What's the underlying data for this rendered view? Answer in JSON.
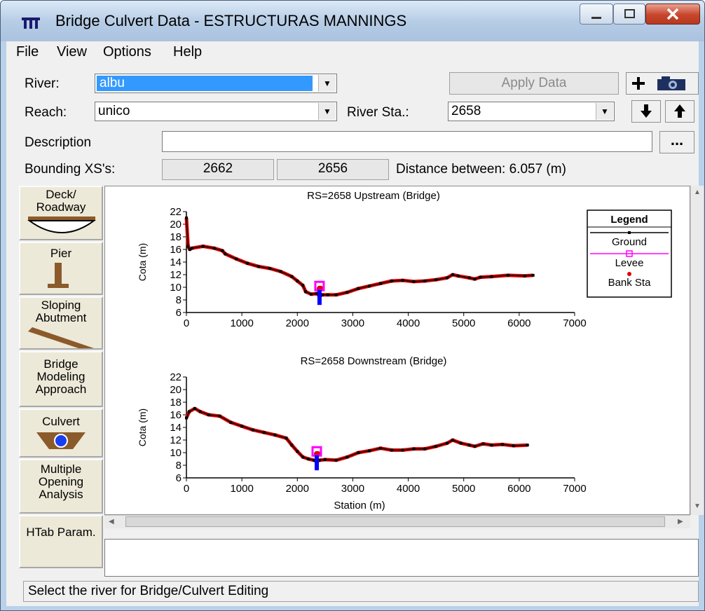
{
  "window": {
    "title": "Bridge Culvert Data - ESTRUCTURAS MANNINGS",
    "icon": "bridge-culvert-app-icon",
    "controls": [
      "minimize-icon",
      "maximize-icon",
      "close-icon"
    ]
  },
  "menu": {
    "items": [
      "File",
      "View",
      "Options",
      "Help"
    ]
  },
  "form": {
    "river_label": "River:",
    "river_value": "albu",
    "reach_label": "Reach:",
    "reach_value": "unico",
    "river_sta_label": "River Sta.:",
    "river_sta_value": "2658",
    "apply_label": "Apply Data",
    "description_label": "Description",
    "description_value": "",
    "ellipsis_label": "...",
    "bounding_label": "Bounding XS's:",
    "bounding_up": "2662",
    "bounding_down": "2656",
    "distance_text": "Distance between: 6.057 (m)",
    "add_icon": "plus-icon",
    "camera_icon": "camera-icon",
    "down_icon": "arrow-down-icon",
    "up_icon": "arrow-up-icon"
  },
  "sidebar": {
    "deck": "Deck/ Roadway",
    "pier": "Pier",
    "sloping": "Sloping Abutment",
    "approach": "Bridge Modeling Approach",
    "culvert": "Culvert",
    "multiple": "Multiple Opening Analysis",
    "htab": "HTab Param."
  },
  "status_text": "Select the river for Bridge/Culvert Editing",
  "colors": {
    "ground": "#000000",
    "profile": "#e00000",
    "levee": "#ff00ff",
    "bank_sta": "#e00000",
    "pier": "#0000ff"
  },
  "chart_data": [
    {
      "type": "line",
      "title": "RS=2658    Upstream  (Bridge)",
      "xlabel": "",
      "ylabel": "Cota (m)",
      "xlim": [
        0,
        7000
      ],
      "ylim": [
        6,
        22
      ],
      "xticks": [
        0,
        1000,
        2000,
        3000,
        4000,
        5000,
        6000,
        7000
      ],
      "yticks": [
        6,
        8,
        10,
        12,
        14,
        16,
        18,
        20,
        22
      ],
      "series": [
        {
          "name": "Ground",
          "x": [
            0,
            30,
            60,
            100,
            300,
            500,
            650,
            700,
            900,
            1100,
            1300,
            1500,
            1700,
            1900,
            2000,
            2100,
            2150,
            2250,
            2350,
            2400,
            2450,
            2550,
            2700,
            2900,
            3100,
            3300,
            3500,
            3700,
            3900,
            4100,
            4300,
            4500,
            4700,
            4800,
            4900,
            5100,
            5200,
            5300,
            5500,
            5800,
            6100,
            6250
          ],
          "y": [
            21,
            16.5,
            16,
            16.2,
            16.5,
            16.2,
            15.8,
            15.3,
            14.5,
            13.8,
            13.3,
            13,
            12.5,
            11.7,
            11,
            10.3,
            9.3,
            8.9,
            9,
            8.6,
            8.8,
            8.8,
            8.8,
            9.2,
            9.8,
            10.2,
            10.6,
            11,
            11.1,
            10.9,
            11,
            11.2,
            11.5,
            12,
            11.8,
            11.5,
            11.3,
            11.6,
            11.7,
            11.9,
            11.8,
            11.9
          ]
        }
      ],
      "bank_sta": [
        2400,
        2420
      ],
      "levee": [
        2400
      ],
      "legend": [
        "Ground",
        "Levee",
        "Bank Sta"
      ],
      "legend_title": "Legend",
      "legend_position": "right"
    },
    {
      "type": "line",
      "title": "RS=2658    Downstream  (Bridge)",
      "xlabel": "Station (m)",
      "ylabel": "Cota (m)",
      "xlim": [
        0,
        7000
      ],
      "ylim": [
        6,
        22
      ],
      "xticks": [
        0,
        1000,
        2000,
        3000,
        4000,
        5000,
        6000,
        7000
      ],
      "yticks": [
        6,
        8,
        10,
        12,
        14,
        16,
        18,
        20,
        22
      ],
      "series": [
        {
          "name": "Ground",
          "x": [
            0,
            50,
            150,
            250,
            400,
            600,
            800,
            1000,
            1200,
            1400,
            1600,
            1800,
            1900,
            2000,
            2100,
            2200,
            2300,
            2350,
            2400,
            2500,
            2700,
            2900,
            3100,
            3300,
            3500,
            3700,
            3900,
            4100,
            4300,
            4500,
            4700,
            4800,
            4950,
            5100,
            5200,
            5350,
            5500,
            5700,
            5900,
            6150
          ],
          "y": [
            15.5,
            16.5,
            17,
            16.5,
            16,
            15.8,
            14.8,
            14.2,
            13.6,
            13.2,
            12.8,
            12.3,
            11.2,
            10.2,
            9.3,
            9,
            8.8,
            8.6,
            8.8,
            8.9,
            8.8,
            9.3,
            10,
            10.3,
            10.7,
            10.4,
            10.4,
            10.6,
            10.6,
            11,
            11.5,
            12,
            11.5,
            11.2,
            11,
            11.4,
            11.2,
            11.3,
            11.1,
            11.2
          ]
        }
      ],
      "bank_sta": [
        2350,
        2370
      ],
      "levee": [
        2350
      ],
      "legend": [],
      "legend_position": "none"
    }
  ]
}
